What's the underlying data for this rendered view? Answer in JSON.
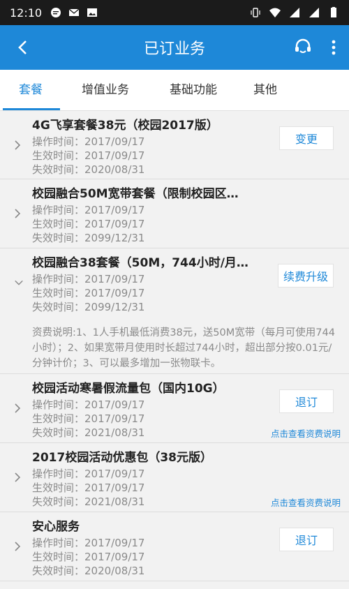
{
  "status_bar": {
    "time": "12:10",
    "icons_left": [
      "message-icon",
      "mail-icon",
      "image-icon"
    ],
    "icons_right": [
      "vibrate-icon",
      "wifi-icon",
      "signal-icon",
      "signal-icon",
      "battery-icon"
    ]
  },
  "app_bar": {
    "title": "已订业务"
  },
  "tabs": [
    {
      "label": "套餐",
      "active": true
    },
    {
      "label": "增值业务",
      "active": false
    },
    {
      "label": "基础功能",
      "active": false
    },
    {
      "label": "其他",
      "active": false
    }
  ],
  "items": [
    {
      "name": "4G飞享套餐38元（校园2017版）",
      "op": "操作时间：2017/09/17",
      "eff": "生效时间：2017/09/17",
      "exp": "失效时间：2020/08/31",
      "button": "变更"
    },
    {
      "name": "校园融合50M宽带套餐（限制校园区…",
      "op": "操作时间：2017/09/17",
      "eff": "生效时间：2017/09/17",
      "exp": "失效时间：2099/12/31"
    },
    {
      "name": "校园融合38套餐（50M，744小时/月…",
      "op": "操作时间：2017/09/17",
      "eff": "生效时间：2017/09/17",
      "exp": "失效时间：2099/12/31",
      "button": "续费升级",
      "description": "资费说明:1、1人手机最低消费38元，送50M宽带（每月可使用744小时）；2、如果宽带月使用时长超过744小时，超出部分按0.01元/分钟计价；3、可以最多增加一张物联卡。"
    },
    {
      "name": "校园活动寒暑假流量包（国内10G）",
      "op": "操作时间：2017/09/17",
      "eff": "生效时间：2017/09/17",
      "exp": "失效时间：2021/08/31",
      "button": "退订",
      "link": "点击查看资费说明"
    },
    {
      "name": "2017校园活动优惠包（38元版）",
      "op": "操作时间：2017/09/17",
      "eff": "生效时间：2017/09/17",
      "exp": "失效时间：2021/08/31",
      "link": "点击查看资费说明"
    },
    {
      "name": "安心服务",
      "op": "操作时间：2017/09/17",
      "eff": "生效时间：2017/09/17",
      "exp": "失效时间：2020/08/31",
      "button": "退订"
    }
  ],
  "colors": {
    "primary": "#1e88d8",
    "status_bar": "#1b1b1b",
    "background": "#f2f2f2"
  }
}
